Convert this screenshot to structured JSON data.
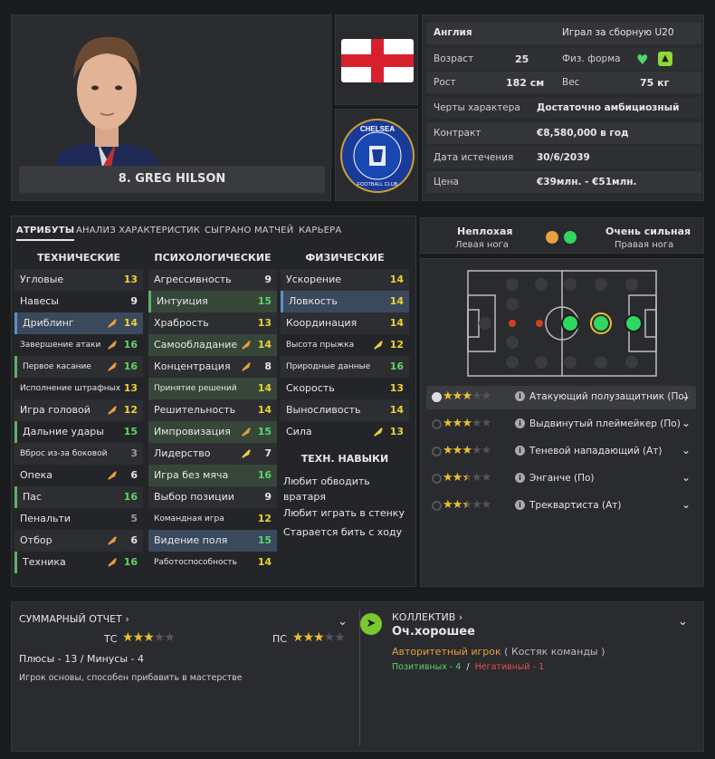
{
  "player": {
    "name": "8. GREG HILSON",
    "nation": "Англия",
    "intl": "Играл за сборную U20",
    "age_label": "Возраст",
    "age": "25",
    "fitness_label": "Физ. форма",
    "height_label": "Рост",
    "height": "182 см",
    "weight_label": "Вес",
    "weight": "75 кг",
    "personality_label": "Черты характера",
    "personality": "Достаточно амбициозный",
    "contract_label": "Контракт",
    "contract": "€8,580,000 в год",
    "expiry_label": "Дата истечения",
    "expiry": "30/6/2039",
    "value_label": "Цена",
    "value": "€39млн. - €51млн.",
    "club_crest_text": "CHELSEA FOOTBALL CLUB"
  },
  "tabs": [
    "АТРИБУТЫ",
    "АНАЛИЗ ХАРАКТЕРИСТИК",
    "СЫГРАНО МАТЧЕЙ",
    "КАРЬЕРА"
  ],
  "headers": {
    "technical": "ТЕХНИЧЕСКИЕ",
    "mental": "ПСИХОЛОГИЧЕСКИЕ",
    "physical": "ФИЗИЧЕСКИЕ",
    "traits": "ТЕХН. НАВЫКИ"
  },
  "technical": [
    {
      "name": "Угловые",
      "value": "13"
    },
    {
      "name": "Навесы",
      "value": "9"
    },
    {
      "name": "Дриблинг",
      "value": "14"
    },
    {
      "name": "Завершение атаки",
      "value": "16"
    },
    {
      "name": "Первое касание",
      "value": "16"
    },
    {
      "name": "Исполнение штрафных",
      "value": "13"
    },
    {
      "name": "Игра головой",
      "value": "12"
    },
    {
      "name": "Дальние удары",
      "value": "15"
    },
    {
      "name": "Вброс из-за боковой",
      "value": "3"
    },
    {
      "name": "Опека",
      "value": "6"
    },
    {
      "name": "Пас",
      "value": "16"
    },
    {
      "name": "Пенальти",
      "value": "5"
    },
    {
      "name": "Отбор",
      "value": "6"
    },
    {
      "name": "Техника",
      "value": "16"
    }
  ],
  "mental": [
    {
      "name": "Агрессивность",
      "value": "9"
    },
    {
      "name": "Интуиция",
      "value": "15"
    },
    {
      "name": "Храбрость",
      "value": "13"
    },
    {
      "name": "Самообладание",
      "value": "14"
    },
    {
      "name": "Концентрация",
      "value": "8"
    },
    {
      "name": "Принятие решений",
      "value": "14"
    },
    {
      "name": "Решительность",
      "value": "14"
    },
    {
      "name": "Импровизация",
      "value": "15"
    },
    {
      "name": "Лидерство",
      "value": "7"
    },
    {
      "name": "Игра без мяча",
      "value": "16"
    },
    {
      "name": "Выбор позиции",
      "value": "9"
    },
    {
      "name": "Командная игра",
      "value": "12"
    },
    {
      "name": "Видение поля",
      "value": "15"
    },
    {
      "name": "Работоспособность",
      "value": "14"
    }
  ],
  "physical": [
    {
      "name": "Ускорение",
      "value": "14"
    },
    {
      "name": "Ловкость",
      "value": "14"
    },
    {
      "name": "Координация",
      "value": "14"
    },
    {
      "name": "Высота прыжка",
      "value": "12"
    },
    {
      "name": "Природные данные",
      "value": "16"
    },
    {
      "name": "Скорость",
      "value": "13"
    },
    {
      "name": "Выносливость",
      "value": "14"
    },
    {
      "name": "Сила",
      "value": "13"
    }
  ],
  "traits": [
    "Любит обводить вратаря",
    "Любит играть в стенку",
    "Старается бить с ходу"
  ],
  "feet": {
    "left_rating": "Неплохая",
    "left_label": "Левая нога",
    "right_rating": "Очень сильная",
    "right_label": "Правая нога",
    "left_color": "#e8a040",
    "right_color": "#2ed860"
  },
  "roles": [
    {
      "name": "Атакующий полузащитник (По)",
      "stars": 3
    },
    {
      "name": "Выдвинутый плеймейкер (По)",
      "stars": 3
    },
    {
      "name": "Теневой нападающий (Ат)",
      "stars": 3
    },
    {
      "name": "Энганче (По)",
      "stars": 2.5
    },
    {
      "name": "Трекварτиста (Ат)",
      "stars": 2.5
    }
  ],
  "report": {
    "title": "СУММАРНЫЙ ОТЧЕТ",
    "tc_label": "ТС",
    "tc_stars": 3,
    "pc_label": "ПС",
    "pc_stars": 3,
    "plus_minus": "Плюсы - 13 / Минусы - 4",
    "summary": "Игрок основы, способен прибавить в мастерстве"
  },
  "team": {
    "title": "КОЛЛЕКТИВ",
    "status": "Оч.хорошее",
    "role": "Авторитетный игрок",
    "role_sub": "( Костяк команды )",
    "positive": "Позитивных - 4",
    "sep": "/",
    "negative": "Негативный - 1"
  }
}
